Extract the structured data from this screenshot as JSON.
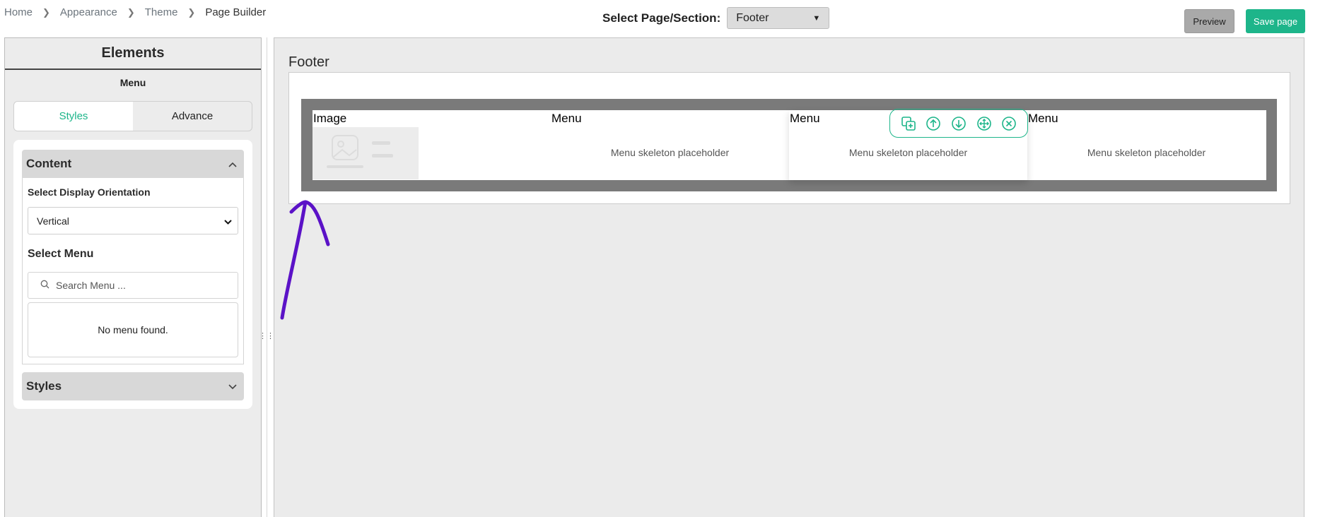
{
  "breadcrumb": [
    "Home",
    "Appearance",
    "Theme",
    "Page Builder"
  ],
  "page_select": {
    "label": "Select Page/Section:",
    "value": "Footer"
  },
  "actions": {
    "preview": "Preview",
    "save": "Save page"
  },
  "sidebar": {
    "title": "Elements",
    "subtitle": "Menu",
    "tabs": [
      "Styles",
      "Advance"
    ],
    "content_section": {
      "title": "Content",
      "orientation_label": "Select Display Orientation",
      "orientation_value": "Vertical",
      "menu_label": "Select Menu",
      "search_placeholder": "Search Menu ...",
      "empty_message": "No menu found."
    },
    "styles_section": {
      "title": "Styles"
    }
  },
  "canvas": {
    "section_title": "Footer",
    "columns": [
      {
        "label": "Image",
        "placeholder": ""
      },
      {
        "label": "Menu",
        "placeholder": "Menu skeleton placeholder"
      },
      {
        "label": "Menu",
        "placeholder": "Menu skeleton placeholder"
      },
      {
        "label": "Menu",
        "placeholder": "Menu skeleton placeholder"
      }
    ],
    "toolbar_icons": [
      "duplicate-icon",
      "move-up-icon",
      "move-down-icon",
      "drag-move-icon",
      "delete-icon"
    ]
  },
  "colors": {
    "accent": "#1db58a",
    "annotation": "#5b12c7"
  }
}
